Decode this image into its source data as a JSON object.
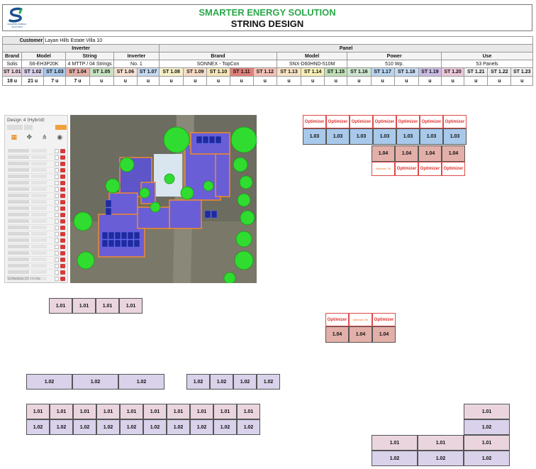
{
  "header": {
    "logo_text": "SMARTER ENERGY SOLUTION",
    "title": "SMARTER ENERGY SOLUTION",
    "subtitle": "STRING DESIGN",
    "logo_color": "#1a4f8f",
    "title_color": "#2aa84a"
  },
  "customer": {
    "label": "Customer",
    "value": "Layan Hills Estate Villa 10"
  },
  "inverter": {
    "group_label": "Inverter",
    "headers": [
      "Brand",
      "Model",
      "String",
      "Inverter"
    ],
    "values": [
      "Solis",
      "S6-EH3P20K",
      "4 MTTP / 04 Strings",
      "No. 1"
    ]
  },
  "panel": {
    "group_label": "Panel",
    "headers": [
      "Brand",
      "Model",
      "Power",
      "Use"
    ],
    "values": [
      "SONNEX - TopCon",
      "SNX-D60HND-510M",
      "510 Wp.",
      "53 Panels"
    ]
  },
  "strings": [
    {
      "label": "ST 1.01",
      "count": "18 u",
      "color": "#ead5df"
    },
    {
      "label": "ST 1.02",
      "count": "21 u",
      "color": "#d9d2ea"
    },
    {
      "label": "ST 1.03",
      "count": "7 u",
      "color": "#a8c9ea"
    },
    {
      "label": "ST 1.04",
      "count": "7 u",
      "color": "#e2b0a8"
    },
    {
      "label": "ST 1.05",
      "count": "u",
      "color": "#c9e3c2"
    },
    {
      "label": "ST 1.06",
      "count": "u",
      "color": "#f7e1d2"
    },
    {
      "label": "ST 1.07",
      "count": "u",
      "color": "#c5daf1"
    },
    {
      "label": "ST 1.08",
      "count": "u",
      "color": "#f6f0c8"
    },
    {
      "label": "ST 1.09",
      "count": "u",
      "color": "#f7dcc6"
    },
    {
      "label": "ST 1.10",
      "count": "u",
      "color": "#f5e6b8"
    },
    {
      "label": "ST 1.11",
      "count": "u",
      "color": "#e0807a"
    },
    {
      "label": "ST 1.12",
      "count": "u",
      "color": "#f3c0b6"
    },
    {
      "label": "ST 1.13",
      "count": "u",
      "color": "#f7e3c4"
    },
    {
      "label": "ST 1.14",
      "count": "u",
      "color": "#f6efb8"
    },
    {
      "label": "ST 1.15",
      "count": "u",
      "color": "#bfe0b6"
    },
    {
      "label": "ST 1.16",
      "count": "u",
      "color": "#cde5cf"
    },
    {
      "label": "ST 1.17",
      "count": "u",
      "color": "#b9d3ef"
    },
    {
      "label": "ST 1.18",
      "count": "u",
      "color": "#c6dbf2"
    },
    {
      "label": "ST 1.19",
      "count": "u",
      "color": "#cbbde6"
    },
    {
      "label": "ST 1.20",
      "count": "u",
      "color": "#ecc8d8"
    },
    {
      "label": "ST 1.21",
      "count": "u",
      "color": "#f0f0f0"
    },
    {
      "label": "ST 1.22",
      "count": "u",
      "color": "#f0f0f0"
    },
    {
      "label": "ST 1.23",
      "count": "u",
      "color": "#f0f0f0"
    }
  ],
  "screenshot": {
    "panel_title": "Design 4 (Hybrid)",
    "footer": "53 Modules, 27.03 kWp",
    "tab_icons": [
      "panels-icon",
      "setbacks-icon",
      "strings-icon",
      "obstacles-icon"
    ],
    "row_count": 22
  },
  "optimizer_label": "Optimizer",
  "optimizer_small_label": "Optimizer-TW",
  "labels": {
    "s101": "1.01",
    "s102": "1.02",
    "s103": "1.03",
    "s104": "1.04"
  }
}
